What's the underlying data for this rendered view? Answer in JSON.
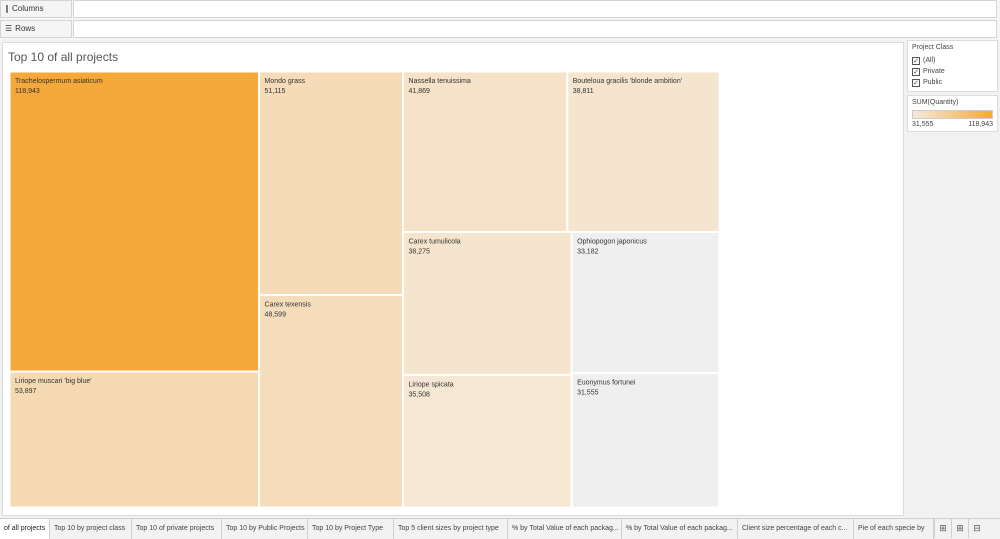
{
  "shelves": {
    "columns_label": "Columns",
    "rows_label": "Rows",
    "columns_icon": "columns-icon",
    "rows_icon": "rows-icon"
  },
  "view": {
    "title": "Top 10 of all projects"
  },
  "filter": {
    "title": "Project Class",
    "options": [
      {
        "label": "(All)",
        "checked": true
      },
      {
        "label": "Private",
        "checked": true
      },
      {
        "label": "Public",
        "checked": true
      }
    ]
  },
  "legend": {
    "title": "SUM(Quantity)",
    "min_label": "31,555",
    "max_label": "118,943",
    "color_low": "#f5eadb",
    "color_high": "#f4a93a"
  },
  "tabs": [
    {
      "label": "of all projects",
      "active": true
    },
    {
      "label": "Top 10 by project class"
    },
    {
      "label": "Top 10 of private projects"
    },
    {
      "label": "Top 10 by Public Projects"
    },
    {
      "label": "Top 10 by Project Type"
    },
    {
      "label": "Top 5 client sizes by project type"
    },
    {
      "label": "% by Total Value of each packag..."
    },
    {
      "label": "% by Total Value of each packag..."
    },
    {
      "label": "Client size percentage of each c..."
    },
    {
      "label": "Pie of each specie by"
    }
  ],
  "tab_icons": [
    "new-dashboard-icon",
    "new-worksheet-icon",
    "new-story-icon"
  ],
  "chart_data": {
    "type": "treemap",
    "title": "Top 10 of all projects",
    "measure": "SUM(Quantity)",
    "color_range": [
      31555,
      118943
    ],
    "items": [
      {
        "name": "Trachelospermum asiaticum",
        "value": 118943,
        "label": "118,943"
      },
      {
        "name": "Liriope muscari 'big blue'",
        "value": 53897,
        "label": "53,897"
      },
      {
        "name": "Mondo grass",
        "value": 51115,
        "label": "51,115"
      },
      {
        "name": "Carex texensis",
        "value": 48599,
        "label": "48,599"
      },
      {
        "name": "Nassella tenuissima",
        "value": 41869,
        "label": "41,869"
      },
      {
        "name": "Bouteloua gracilis 'blonde ambition'",
        "value": 38811,
        "label": "38,811"
      },
      {
        "name": "Carex tumulicola",
        "value": 38275,
        "label": "38,275"
      },
      {
        "name": "Liriope spicata",
        "value": 35508,
        "label": "35,508"
      },
      {
        "name": "Ophiopogon japonicus",
        "value": 33182,
        "label": "33,182"
      },
      {
        "name": "Euonymus fortunei",
        "value": 31555,
        "label": "31,555"
      }
    ]
  }
}
